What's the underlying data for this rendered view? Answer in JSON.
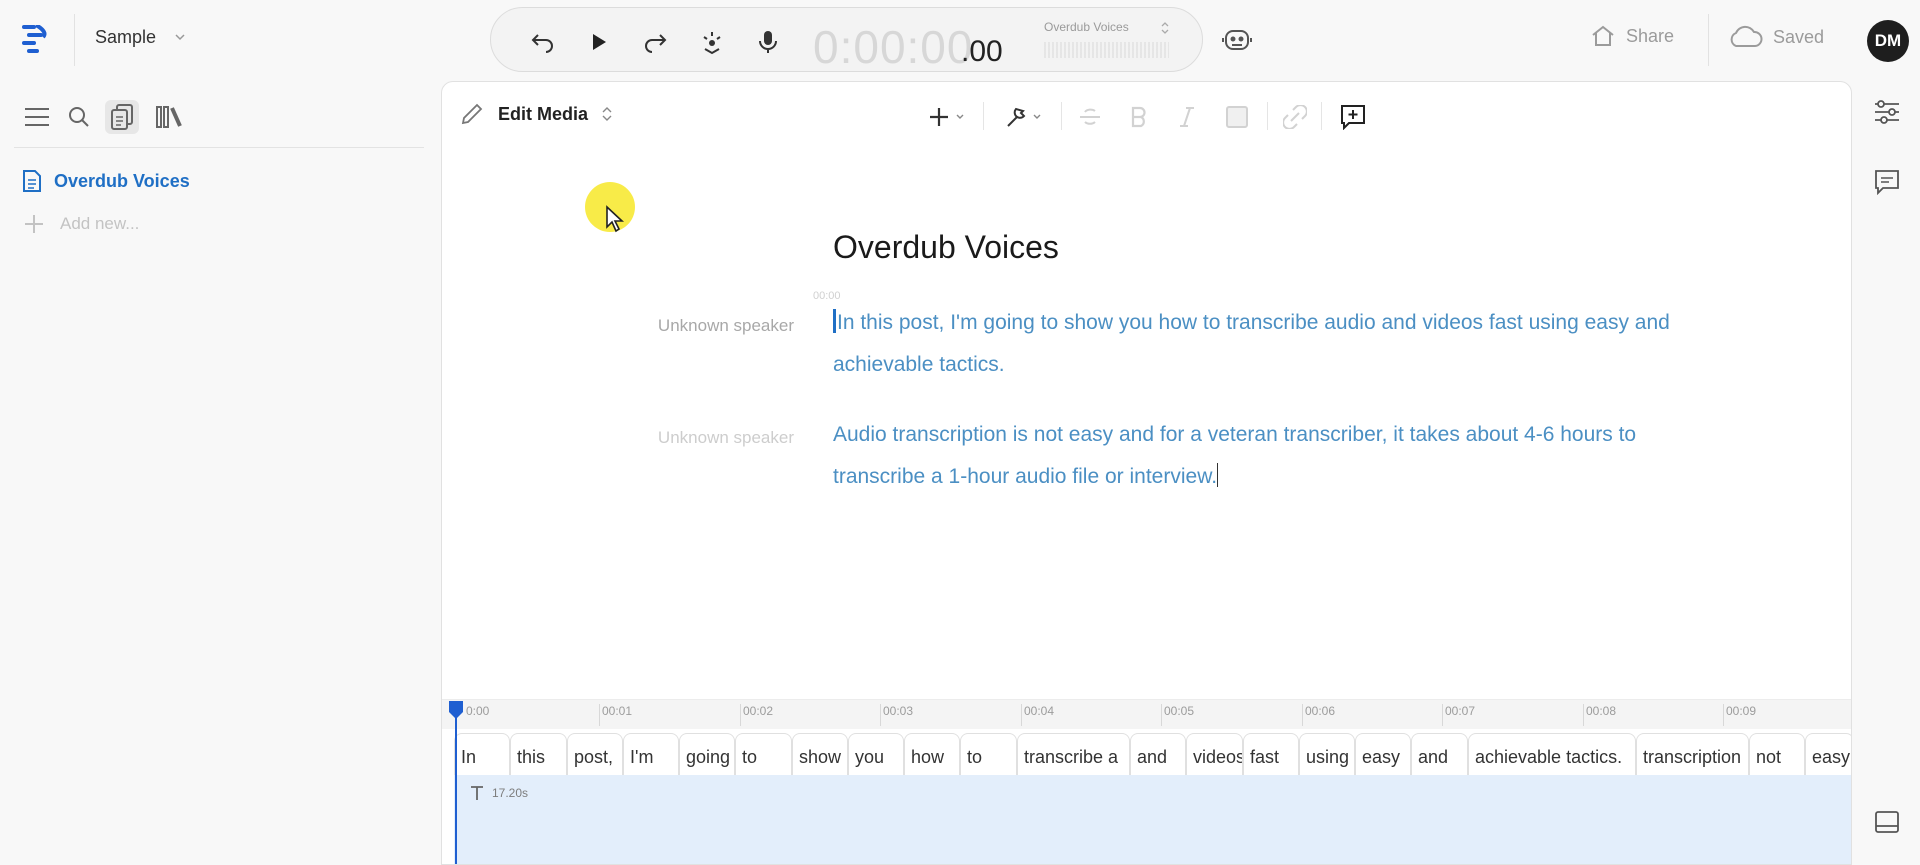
{
  "header": {
    "project_name": "Sample",
    "timecode_main": "0:00:00",
    "timecode_fraction": ".00",
    "voice_selector": "Overdub Voices",
    "share_label": "Share",
    "saved_label": "Saved",
    "avatar_initials": "DM"
  },
  "sidebar": {
    "document_title": "Overdub Voices",
    "add_new_label": "Add new..."
  },
  "toolbar": {
    "mode_label": "Edit Media"
  },
  "document": {
    "title": "Overdub Voices",
    "first_timestamp": "00:00",
    "paragraphs": [
      {
        "speaker": "Unknown speaker",
        "text": "In this post, I'm going to show you how to transcribe audio and videos fast using easy and achievable tactics."
      },
      {
        "speaker": "Unknown speaker",
        "text": "Audio transcription is not easy and for a veteran transcriber, it takes about 4-6 hours to transcribe a 1-hour audio file or interview."
      }
    ]
  },
  "timeline": {
    "ticks": [
      "0:00",
      "00:01",
      "00:02",
      "00:03",
      "00:04",
      "00:05",
      "00:06",
      "00:07",
      "00:08",
      "00:09"
    ],
    "words": [
      "In",
      "this",
      "post,",
      "I'm",
      "going",
      "to",
      "show",
      "you",
      "how",
      "to",
      "transcribe a",
      "and",
      "videos",
      "fast",
      "using",
      "easy",
      "and",
      "achievable tactics.",
      "transcription",
      "not",
      "easy"
    ],
    "track_duration": "17.20s"
  },
  "colors": {
    "accent": "#1f6fc5",
    "transcript_text": "#4b8fc3",
    "track_bg": "#e3eefb",
    "playhead": "#1f5fd1"
  },
  "icons": [
    "app-logo-icon",
    "undo-icon",
    "play-icon",
    "redo-icon",
    "sparkle-icon",
    "microphone-icon",
    "robot-icon",
    "home-icon",
    "cloud-icon",
    "menu-icon",
    "search-icon",
    "documents-icon",
    "library-icon",
    "pencil-icon",
    "plus-icon",
    "wrench-icon",
    "strikethrough-icon",
    "bold-icon",
    "italic-icon",
    "highlight-icon",
    "link-icon",
    "add-comment-icon",
    "properties-icon",
    "comment-icon",
    "panel-icon"
  ]
}
